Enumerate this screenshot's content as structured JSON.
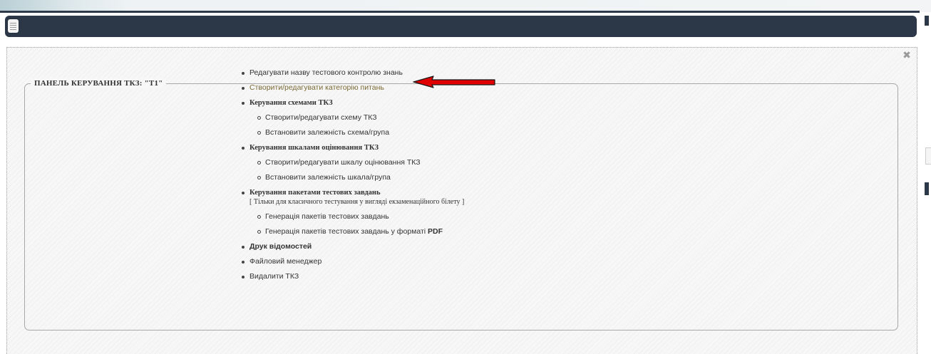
{
  "panel": {
    "title": "ПАНЕЛЬ КЕРУВАННЯ ТКЗ: \"Т1\""
  },
  "menu": {
    "edit_name": "Редагувати назву тестового контролю знань",
    "edit_category": "Створити/редагувати категорію питань",
    "schemes": {
      "label": "Керування схемами ТКЗ",
      "items": [
        "Створити/редагувати схему ТКЗ",
        "Встановити залежність схема/група"
      ]
    },
    "scales": {
      "label": "Керування шкалами оцінювання ТКЗ",
      "items": [
        "Створити/редагувати шкалу оцінювання ТКЗ",
        "Встановити залежність шкала/група"
      ]
    },
    "packages": {
      "label": "Керування пакетами тестових завдань",
      "note": "[ Тільки для класичного тестування у вигляді екзаменаційного білету ]",
      "items": [
        "Генерація пакетів тестових завдань",
        "Генерація пакетів тестових завдань у форматі "
      ],
      "pdf_label": "PDF"
    },
    "print": "Друк відомостей",
    "file_manager": "Файловий менеджер",
    "delete": "Видалити ТКЗ"
  },
  "icons": {
    "menu": "menu-icon",
    "close": "close-icon",
    "arrow": "red-arrow-annotation"
  },
  "colors": {
    "header": "#2c3848",
    "link_highlight": "#7a6a35",
    "arrow": "#e00000"
  }
}
